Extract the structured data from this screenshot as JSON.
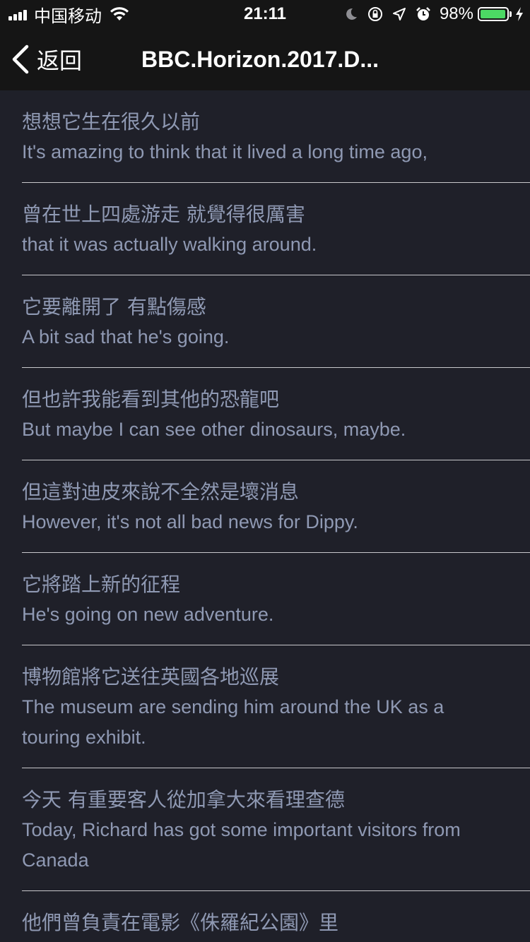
{
  "status_bar": {
    "carrier": "中国移动",
    "time": "21:11",
    "battery_percent": "98%",
    "battery_level": 0.98,
    "icons": [
      "signal-icon",
      "wifi-icon",
      "moon-icon",
      "orientation-lock-icon",
      "location-icon",
      "alarm-icon",
      "battery-icon",
      "charging-bolt-icon"
    ],
    "battery_color": "#4cd964"
  },
  "nav": {
    "back_label": "返回",
    "title": "BBC.Horizon.2017.D..."
  },
  "colors": {
    "background": "#1f2029",
    "bar_background": "#151515",
    "text": "#8f99b3",
    "divider": "#c8c8cc"
  },
  "subtitles": [
    {
      "zh": "想想它生在很久以前",
      "en": "It's amazing to think that it lived a long time ago,"
    },
    {
      "zh": "曾在世上四處游走  就覺得很厲害",
      "en": "that it was actually walking around."
    },
    {
      "zh": "它要離開了  有點傷感",
      "en": "A bit sad that he's going."
    },
    {
      "zh": "但也許我能看到其他的恐龍吧",
      "en": "But maybe I can see other dinosaurs, maybe."
    },
    {
      "zh": "但這對迪皮來說不全然是壞消息",
      "en": "However, it's not all bad news for Dippy."
    },
    {
      "zh": "它將踏上新的征程",
      "en": "He's going on new adventure."
    },
    {
      "zh": "博物館將它送往英國各地巡展",
      "en": "The museum are sending him around the UK as a touring exhibit."
    },
    {
      "zh": "今天  有重要客人從加拿大來看理查德",
      "en": "Today, Richard has got some important visitors from Canada"
    },
    {
      "zh": "他們曾負責在電影《侏羅紀公園》里",
      "en": ""
    }
  ]
}
